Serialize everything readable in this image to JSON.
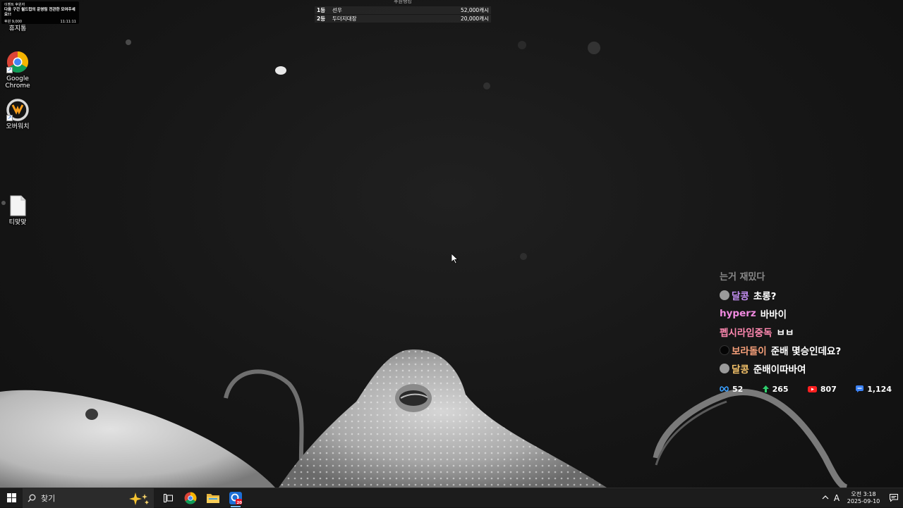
{
  "desktop": {
    "icons": [
      {
        "label": "휴지통"
      },
      {
        "label": "Google\nChrome"
      },
      {
        "label": "오버워치"
      },
      {
        "label": "티맞맞"
      }
    ]
  },
  "overlay_top_left": {
    "line1": "이벤트 후원자",
    "line2": "다음 구간 월드컵의 운영팀 전관한 모여주세요!!",
    "line3_left": "후원 9,000",
    "line3_right": "11:11:11"
  },
  "donation_ranking": {
    "title": "후원랭킹",
    "rows": [
      {
        "rank": "1등",
        "name": "선우",
        "amount": "52,000캐시"
      },
      {
        "rank": "2등",
        "name": "두더지대장",
        "amount": "20,000캐시"
      }
    ]
  },
  "chat": {
    "faded_line": "는거 재밌다",
    "messages": [
      {
        "nick": "달콩",
        "text": "초롱?",
        "nick_color": "#c38ef2",
        "emote": "gray"
      },
      {
        "nick": "hyperz",
        "text": "바바이",
        "nick_color": "#f08ae0",
        "emote": ""
      },
      {
        "nick": "펩시라임중독",
        "text": "ㅂㅂ",
        "nick_color": "#ff88b0",
        "emote": ""
      },
      {
        "nick": "보라돌이",
        "text": "준배 몇승인데요?",
        "nick_color": "#f7a07a",
        "emote": "dark"
      },
      {
        "nick": "달콩",
        "text": "준배이따바여",
        "nick_color": "#f5c36a",
        "emote": "gray"
      }
    ]
  },
  "stats": {
    "items": [
      {
        "icon": "infinity-icon",
        "value": "52",
        "color": "#3aa0ff"
      },
      {
        "icon": "upvote-icon",
        "value": "265",
        "color": "#2ed06e"
      },
      {
        "icon": "youtube-icon",
        "value": "807",
        "color": "#ff2020"
      },
      {
        "icon": "chat-bubble-icon",
        "value": "1,124",
        "color": "#3b82f6"
      }
    ]
  },
  "taskbar": {
    "search_placeholder": "찾기",
    "ime": "A",
    "time": "오전 3:18",
    "date": "2025-09-10",
    "notif_badge": "20"
  }
}
